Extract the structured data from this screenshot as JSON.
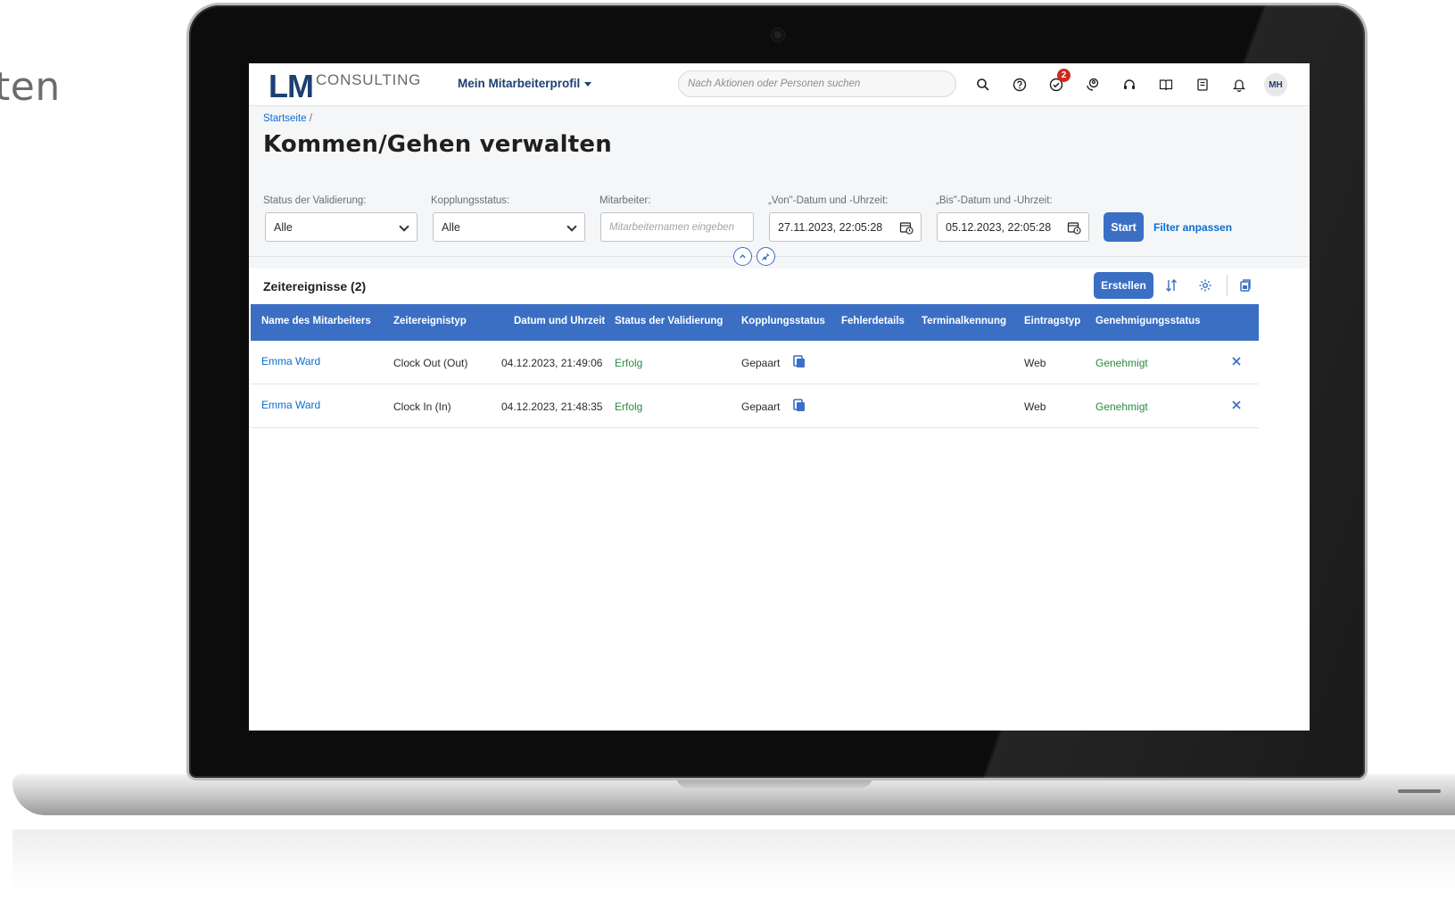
{
  "side_text": "ten",
  "shell": {
    "logo_main": "LM",
    "logo_sub": "CONSULTING",
    "profile_menu": "Mein Mitarbeiterprofil",
    "search_placeholder": "Nach Aktionen oder Personen suchen",
    "notification_badge": "2",
    "avatar_initials": "MH",
    "icons": [
      "search-icon",
      "help-icon",
      "tasks-icon",
      "user-feedback-icon",
      "headset-icon",
      "book-icon",
      "guide-icon",
      "bell-icon"
    ]
  },
  "breadcrumb": {
    "home": "Startseite",
    "separator": "/"
  },
  "page_title": "Kommen/Gehen verwalten",
  "filters": {
    "validation_label": "Status der Validierung:",
    "validation_value": "Alle",
    "coupling_label": "Kopplungsstatus:",
    "coupling_value": "Alle",
    "employee_label": "Mitarbeiter:",
    "employee_placeholder": "Mitarbeiternamen eingeben",
    "from_label": "„Von\"-Datum und -Uhrzeit:",
    "from_value": "27.11.2023, 22:05:28",
    "to_label": "„Bis\"-Datum und -Uhrzeit:",
    "to_value": "05.12.2023, 22:05:28",
    "start_button": "Start",
    "adapt_link": "Filter anpassen"
  },
  "table": {
    "title": "Zeitereignisse (2)",
    "create_button": "Erstellen",
    "columns": [
      "Name des Mitarbeiters",
      "Zeitereignistyp",
      "Datum und Uhrzeit",
      "Status der Validierung",
      "Kopplungsstatus",
      "Fehlerdetails",
      "Terminalkennung",
      "Eintragstyp",
      "Genehmigungsstatus"
    ],
    "rows": [
      {
        "name": "Emma Ward",
        "type": "Clock Out (Out)",
        "datetime": "04.12.2023, 21:49:06",
        "validation": "Erfolg",
        "coupling": "Gepaart",
        "error": "",
        "terminal": "",
        "entry": "Web",
        "approval": "Genehmigt"
      },
      {
        "name": "Emma Ward",
        "type": "Clock In (In)",
        "datetime": "04.12.2023, 21:48:35",
        "validation": "Erfolg",
        "coupling": "Gepaart",
        "error": "",
        "terminal": "",
        "entry": "Web",
        "approval": "Genehmigt"
      }
    ]
  },
  "colors": {
    "accent": "#3a6fc4",
    "brand": "#1d3f73",
    "link": "#0a6ed1",
    "success": "#2b8a3e",
    "badge": "#d0271d"
  }
}
